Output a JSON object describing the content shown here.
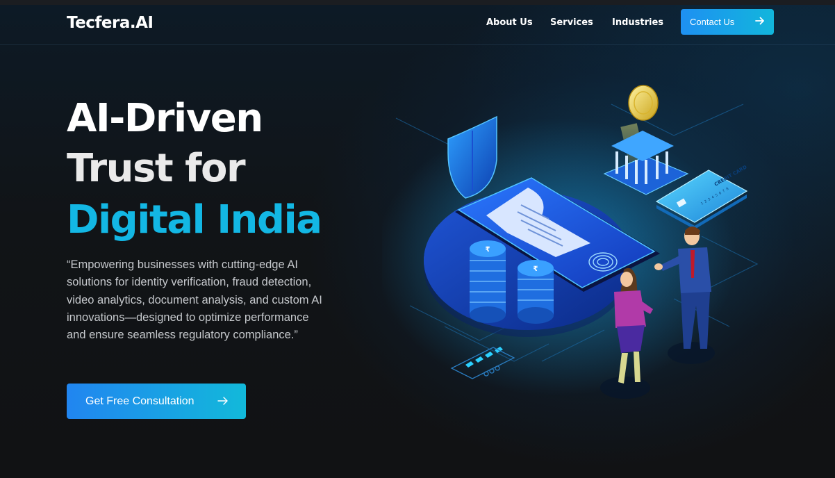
{
  "brand": {
    "logo": "Tecfera.AI"
  },
  "nav": {
    "links": [
      "About Us",
      "Services",
      "Industries"
    ],
    "contact_label": "Contact Us"
  },
  "hero": {
    "title_line1": "AI-Driven",
    "title_line2": "Trust for",
    "title_line3": "Digital India",
    "description": "“Empowering businesses with cutting-edge AI solutions for identity verification, fraud detection, video analytics, document analysis, and custom AI innovations—designed to optimize performance and ensure seamless regulatory compliance.”",
    "cta_label": "Get Free Consultation"
  },
  "illustration": {
    "card_text": "CREDIT CARD",
    "card_number": "1 2 3 4 5 6 7 8"
  },
  "colors": {
    "accent": "#13b7e4",
    "button_start": "#1e90f2",
    "button_end": "#12b6dc",
    "background": "#111214"
  },
  "icons": [
    "arrow-right-icon",
    "shield-icon",
    "bank-icon",
    "coin-icon",
    "credit-card-icon",
    "fingerprint-icon",
    "smartphone-icon",
    "receipt-icon",
    "coin-stack-icon"
  ]
}
